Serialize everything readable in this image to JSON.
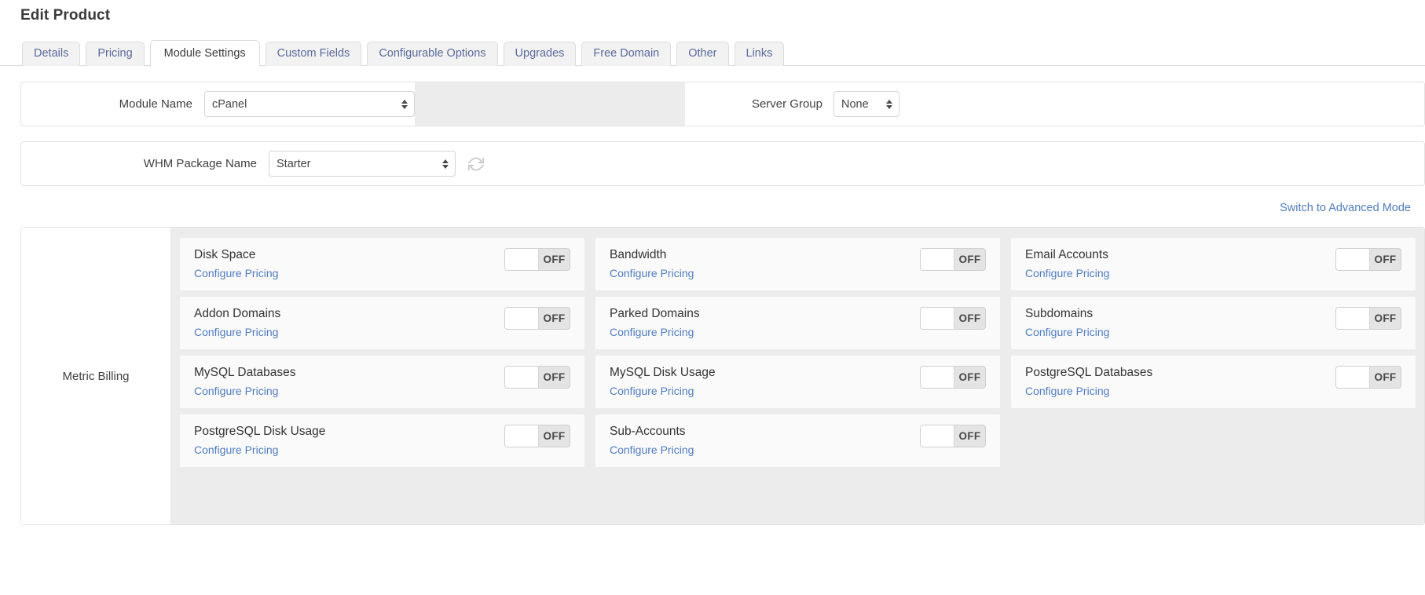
{
  "header": {
    "title": "Edit Product"
  },
  "tabs": [
    {
      "label": "Details",
      "active": false
    },
    {
      "label": "Pricing",
      "active": false
    },
    {
      "label": "Module Settings",
      "active": true
    },
    {
      "label": "Custom Fields",
      "active": false
    },
    {
      "label": "Configurable Options",
      "active": false
    },
    {
      "label": "Upgrades",
      "active": false
    },
    {
      "label": "Free Domain",
      "active": false
    },
    {
      "label": "Other",
      "active": false
    },
    {
      "label": "Links",
      "active": false
    }
  ],
  "form": {
    "module_name_label": "Module Name",
    "module_name_value": "cPanel",
    "server_group_label": "Server Group",
    "server_group_value": "None",
    "whm_package_label": "WHM Package Name",
    "whm_package_value": "Starter",
    "refresh_icon": "refresh-icon"
  },
  "advanced": {
    "link_label": "Switch to Advanced Mode"
  },
  "metric_billing": {
    "section_label": "Metric Billing",
    "configure_label": "Configure Pricing",
    "toggle_state": "OFF",
    "items": [
      {
        "name": "Disk Space",
        "state": "OFF",
        "link": "Configure Pricing"
      },
      {
        "name": "Bandwidth",
        "state": "OFF",
        "link": "Configure Pricing"
      },
      {
        "name": "Email Accounts",
        "state": "OFF",
        "link": "Configure Pricing"
      },
      {
        "name": "Addon Domains",
        "state": "OFF",
        "link": "Configure Pricing"
      },
      {
        "name": "Parked Domains",
        "state": "OFF",
        "link": "Configure Pricing"
      },
      {
        "name": "Subdomains",
        "state": "OFF",
        "link": "Configure Pricing"
      },
      {
        "name": "MySQL Databases",
        "state": "OFF",
        "link": "Configure Pricing"
      },
      {
        "name": "MySQL Disk Usage",
        "state": "OFF",
        "link": "Configure Pricing"
      },
      {
        "name": "PostgreSQL Databases",
        "state": "OFF",
        "link": "Configure Pricing"
      },
      {
        "name": "PostgreSQL Disk Usage",
        "state": "OFF",
        "link": "Configure Pricing"
      },
      {
        "name": "Sub-Accounts",
        "state": "OFF",
        "link": "Configure Pricing"
      }
    ]
  },
  "colors": {
    "link": "#4f7bbf",
    "tab_text": "#5a6a9a",
    "panel_bg": "#ececec",
    "card_bg": "#fafafa"
  }
}
